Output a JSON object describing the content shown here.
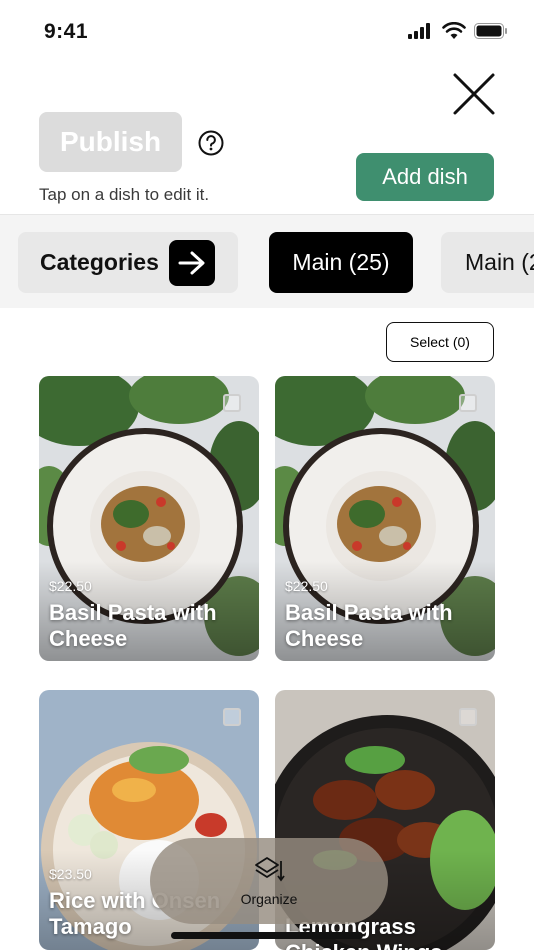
{
  "status": {
    "time": "9:41"
  },
  "header": {
    "publish_label": "Publish",
    "hint": "Tap on a dish to edit it.",
    "add_dish_label": "Add dish"
  },
  "categories": {
    "categories_label": "Categories",
    "tabs": [
      {
        "label": "Main (25)",
        "active": true
      },
      {
        "label": "Main (2"
      }
    ]
  },
  "select_label": "Select (0)",
  "dishes": [
    {
      "price": "$22.50",
      "name": "Basil Pasta with Cheese"
    },
    {
      "price": "$22.50",
      "name": "Basil Pasta with Cheese"
    },
    {
      "price": "$23.50",
      "name": "Rice with Onsen Tamago"
    },
    {
      "price": "",
      "name": "Lemongrass Chicken Wings"
    }
  ],
  "organize": {
    "label": "Organize"
  },
  "colors": {
    "accent": "#3f8f6f",
    "publish_disabled": "#dcdcdc"
  }
}
